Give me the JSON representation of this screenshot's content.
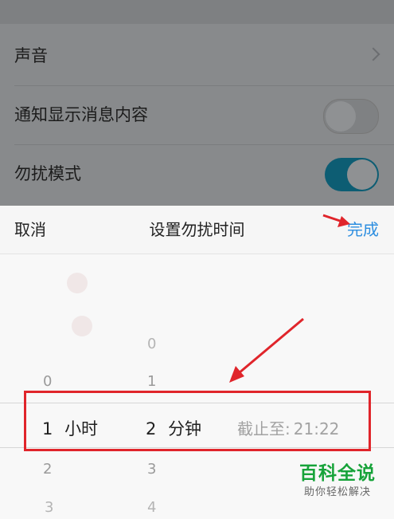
{
  "settings": {
    "rows": [
      {
        "label": "声音",
        "control": "chevron-right-icon"
      },
      {
        "label": "通知显示消息内容",
        "control": "toggle",
        "state": "off"
      },
      {
        "label": "勿扰模式",
        "control": "toggle",
        "state": "on"
      }
    ]
  },
  "sheet": {
    "cancel_label": "取消",
    "title": "设置勿扰时间",
    "done_label": "完成",
    "done_color": "#2d8ee0"
  },
  "picker": {
    "hours": {
      "above": [
        "0"
      ],
      "selected": "1",
      "unit": "小时",
      "below": [
        "2",
        "3"
      ]
    },
    "minutes": {
      "above": [
        "0",
        "1"
      ],
      "selected": "2",
      "unit": "分钟",
      "below": [
        "3",
        "4"
      ]
    },
    "deadline_label": "截止至:",
    "deadline_time": "21:22"
  },
  "annotation": {
    "color": "#e0252b",
    "shapes": [
      "highlight-box",
      "arrow",
      "arrow"
    ]
  },
  "watermark": {
    "main": "百科全说",
    "sub": "助你轻松解决"
  }
}
